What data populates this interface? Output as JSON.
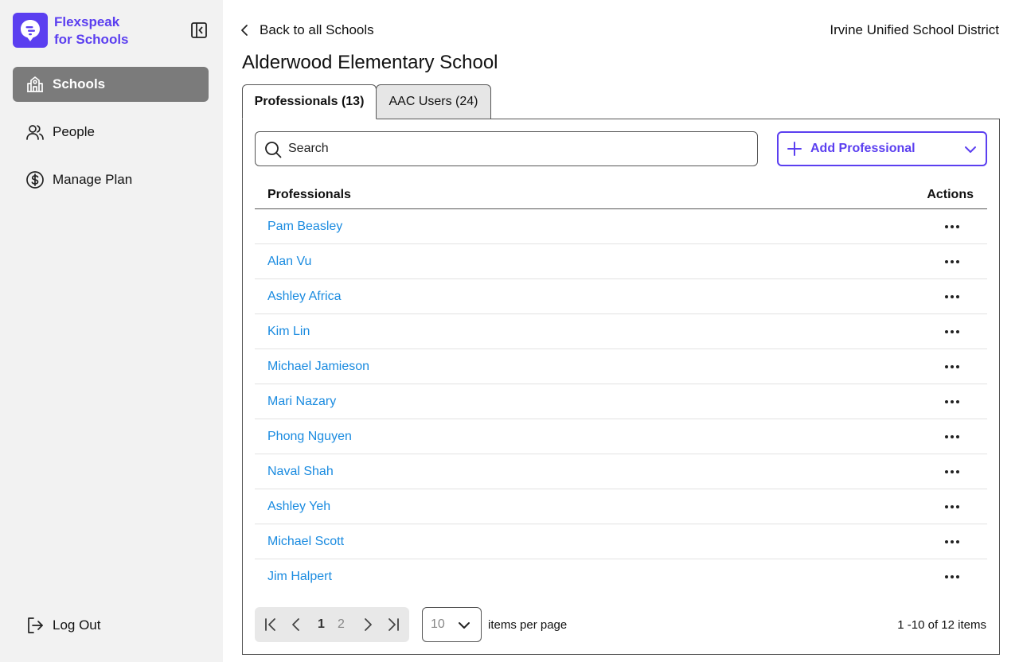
{
  "brand": {
    "line1": "Flexspeak",
    "line2": "for Schools",
    "color": "#5b3ff0"
  },
  "sidebar": {
    "items": [
      {
        "label": "Schools",
        "icon": "school-icon",
        "active": true
      },
      {
        "label": "People",
        "icon": "people-icon",
        "active": false
      },
      {
        "label": "Manage Plan",
        "icon": "dollar-circle-icon",
        "active": false
      }
    ],
    "logout_label": "Log Out"
  },
  "header": {
    "back_label": "Back to all Schools",
    "district": "Irvine Unified School District",
    "title": "Alderwood Elementary School"
  },
  "tabs": [
    {
      "label": "Professionals (13)",
      "active": true
    },
    {
      "label": "AAC Users (24)",
      "active": false
    }
  ],
  "search": {
    "placeholder": "Search",
    "value": ""
  },
  "add_button": {
    "label": "Add Professional"
  },
  "table": {
    "headers": {
      "name": "Professionals",
      "actions": "Actions"
    },
    "rows": [
      "Pam Beasley",
      "Alan Vu",
      "Ashley Africa",
      "Kim Lin",
      "Michael Jamieson",
      "Mari Nazary",
      "Phong Nguyen",
      "Naval Shah",
      "Ashley Yeh",
      "Michael Scott",
      "Jim Halpert"
    ]
  },
  "pagination": {
    "current_page": "1",
    "other_page": "2",
    "per_page": "10",
    "per_page_label": "items per page",
    "summary": "1 -10 of 12 items"
  },
  "colors": {
    "accent": "#5b3ff0",
    "link": "#1a8be0",
    "sidebar_active": "#7b7b7b"
  }
}
